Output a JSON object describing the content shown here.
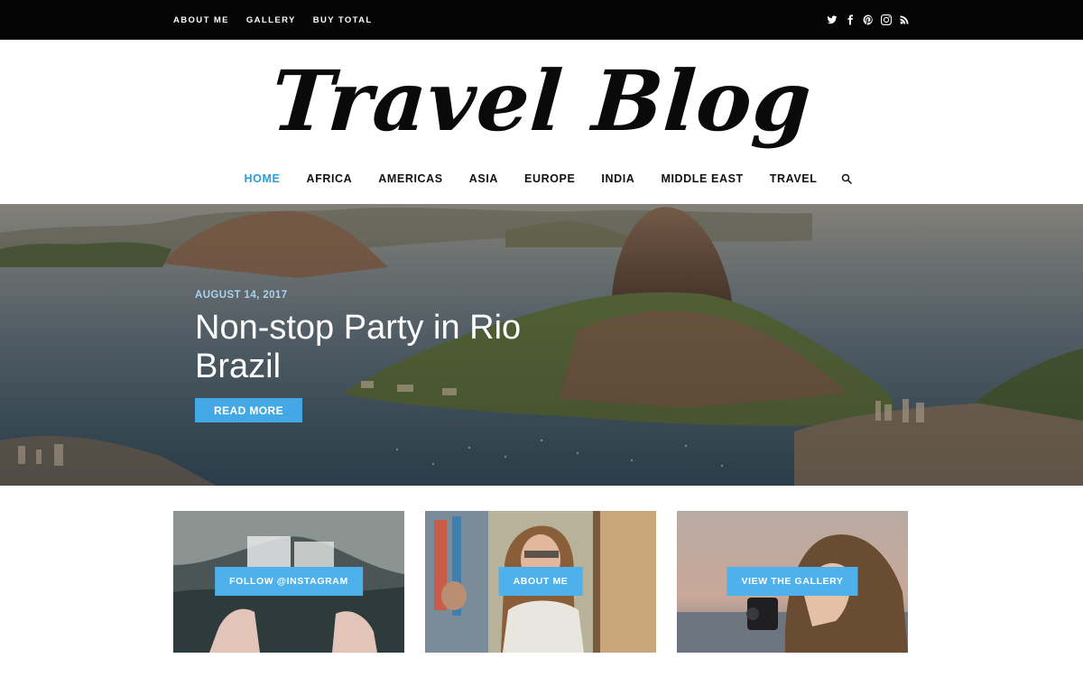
{
  "topbar": {
    "links": [
      "ABOUT ME",
      "GALLERY",
      "BUY TOTAL"
    ],
    "social_icons": [
      "twitter-icon",
      "facebook-icon",
      "pinterest-icon",
      "instagram-icon",
      "rss-icon"
    ]
  },
  "logo": {
    "text": "Travel Blog"
  },
  "nav": {
    "items": [
      "HOME",
      "AFRICA",
      "AMERICAS",
      "ASIA",
      "EUROPE",
      "INDIA",
      "MIDDLE EAST",
      "TRAVEL"
    ],
    "active": "HOME",
    "search_icon": "search-icon"
  },
  "hero": {
    "date": "AUGUST 14, 2017",
    "title": "Non-stop Party in Rio Brazil",
    "button": "READ MORE"
  },
  "slider_thumbs": {
    "count": 3,
    "active_index": 2
  },
  "cards": [
    {
      "button": "FOLLOW @INSTAGRAM"
    },
    {
      "button": "ABOUT ME"
    },
    {
      "button": "VIEW THE GALLERY"
    }
  ],
  "colors": {
    "accent": "#2d9cdb",
    "button": "#45a8e6",
    "topbar": "#050505",
    "hero_date": "#a8d2ef"
  }
}
